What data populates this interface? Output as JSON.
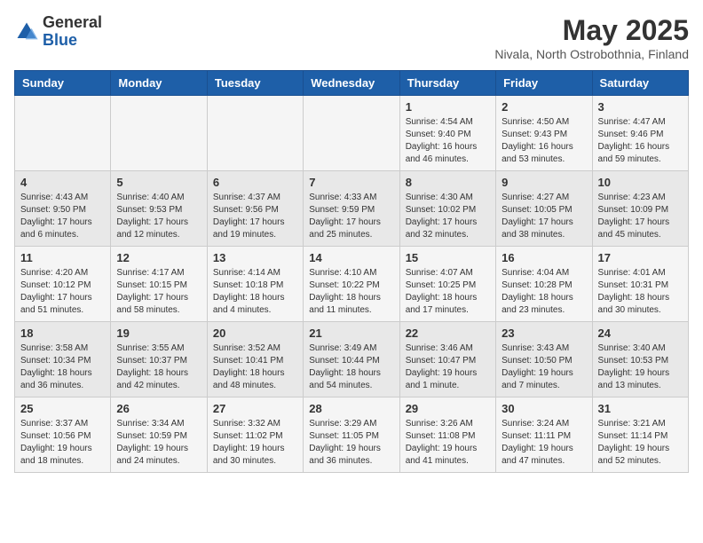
{
  "logo": {
    "general": "General",
    "blue": "Blue"
  },
  "title": {
    "month": "May 2025",
    "location": "Nivala, North Ostrobothnia, Finland"
  },
  "weekdays": [
    "Sunday",
    "Monday",
    "Tuesday",
    "Wednesday",
    "Thursday",
    "Friday",
    "Saturday"
  ],
  "weeks": [
    [
      {
        "day": "",
        "info": ""
      },
      {
        "day": "",
        "info": ""
      },
      {
        "day": "",
        "info": ""
      },
      {
        "day": "",
        "info": ""
      },
      {
        "day": "1",
        "info": "Sunrise: 4:54 AM\nSunset: 9:40 PM\nDaylight: 16 hours\nand 46 minutes."
      },
      {
        "day": "2",
        "info": "Sunrise: 4:50 AM\nSunset: 9:43 PM\nDaylight: 16 hours\nand 53 minutes."
      },
      {
        "day": "3",
        "info": "Sunrise: 4:47 AM\nSunset: 9:46 PM\nDaylight: 16 hours\nand 59 minutes."
      }
    ],
    [
      {
        "day": "4",
        "info": "Sunrise: 4:43 AM\nSunset: 9:50 PM\nDaylight: 17 hours\nand 6 minutes."
      },
      {
        "day": "5",
        "info": "Sunrise: 4:40 AM\nSunset: 9:53 PM\nDaylight: 17 hours\nand 12 minutes."
      },
      {
        "day": "6",
        "info": "Sunrise: 4:37 AM\nSunset: 9:56 PM\nDaylight: 17 hours\nand 19 minutes."
      },
      {
        "day": "7",
        "info": "Sunrise: 4:33 AM\nSunset: 9:59 PM\nDaylight: 17 hours\nand 25 minutes."
      },
      {
        "day": "8",
        "info": "Sunrise: 4:30 AM\nSunset: 10:02 PM\nDaylight: 17 hours\nand 32 minutes."
      },
      {
        "day": "9",
        "info": "Sunrise: 4:27 AM\nSunset: 10:05 PM\nDaylight: 17 hours\nand 38 minutes."
      },
      {
        "day": "10",
        "info": "Sunrise: 4:23 AM\nSunset: 10:09 PM\nDaylight: 17 hours\nand 45 minutes."
      }
    ],
    [
      {
        "day": "11",
        "info": "Sunrise: 4:20 AM\nSunset: 10:12 PM\nDaylight: 17 hours\nand 51 minutes."
      },
      {
        "day": "12",
        "info": "Sunrise: 4:17 AM\nSunset: 10:15 PM\nDaylight: 17 hours\nand 58 minutes."
      },
      {
        "day": "13",
        "info": "Sunrise: 4:14 AM\nSunset: 10:18 PM\nDaylight: 18 hours\nand 4 minutes."
      },
      {
        "day": "14",
        "info": "Sunrise: 4:10 AM\nSunset: 10:22 PM\nDaylight: 18 hours\nand 11 minutes."
      },
      {
        "day": "15",
        "info": "Sunrise: 4:07 AM\nSunset: 10:25 PM\nDaylight: 18 hours\nand 17 minutes."
      },
      {
        "day": "16",
        "info": "Sunrise: 4:04 AM\nSunset: 10:28 PM\nDaylight: 18 hours\nand 23 minutes."
      },
      {
        "day": "17",
        "info": "Sunrise: 4:01 AM\nSunset: 10:31 PM\nDaylight: 18 hours\nand 30 minutes."
      }
    ],
    [
      {
        "day": "18",
        "info": "Sunrise: 3:58 AM\nSunset: 10:34 PM\nDaylight: 18 hours\nand 36 minutes."
      },
      {
        "day": "19",
        "info": "Sunrise: 3:55 AM\nSunset: 10:37 PM\nDaylight: 18 hours\nand 42 minutes."
      },
      {
        "day": "20",
        "info": "Sunrise: 3:52 AM\nSunset: 10:41 PM\nDaylight: 18 hours\nand 48 minutes."
      },
      {
        "day": "21",
        "info": "Sunrise: 3:49 AM\nSunset: 10:44 PM\nDaylight: 18 hours\nand 54 minutes."
      },
      {
        "day": "22",
        "info": "Sunrise: 3:46 AM\nSunset: 10:47 PM\nDaylight: 19 hours\nand 1 minute."
      },
      {
        "day": "23",
        "info": "Sunrise: 3:43 AM\nSunset: 10:50 PM\nDaylight: 19 hours\nand 7 minutes."
      },
      {
        "day": "24",
        "info": "Sunrise: 3:40 AM\nSunset: 10:53 PM\nDaylight: 19 hours\nand 13 minutes."
      }
    ],
    [
      {
        "day": "25",
        "info": "Sunrise: 3:37 AM\nSunset: 10:56 PM\nDaylight: 19 hours\nand 18 minutes."
      },
      {
        "day": "26",
        "info": "Sunrise: 3:34 AM\nSunset: 10:59 PM\nDaylight: 19 hours\nand 24 minutes."
      },
      {
        "day": "27",
        "info": "Sunrise: 3:32 AM\nSunset: 11:02 PM\nDaylight: 19 hours\nand 30 minutes."
      },
      {
        "day": "28",
        "info": "Sunrise: 3:29 AM\nSunset: 11:05 PM\nDaylight: 19 hours\nand 36 minutes."
      },
      {
        "day": "29",
        "info": "Sunrise: 3:26 AM\nSunset: 11:08 PM\nDaylight: 19 hours\nand 41 minutes."
      },
      {
        "day": "30",
        "info": "Sunrise: 3:24 AM\nSunset: 11:11 PM\nDaylight: 19 hours\nand 47 minutes."
      },
      {
        "day": "31",
        "info": "Sunrise: 3:21 AM\nSunset: 11:14 PM\nDaylight: 19 hours\nand 52 minutes."
      }
    ]
  ]
}
